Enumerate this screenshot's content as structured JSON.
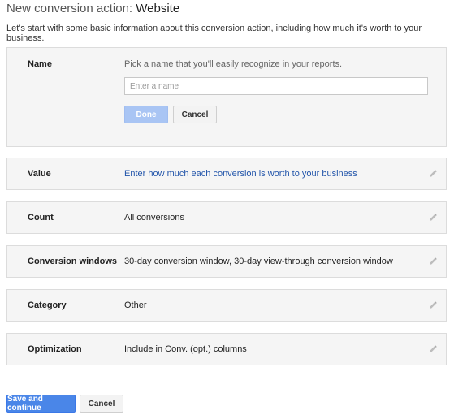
{
  "header": {
    "title_prefix": "New conversion action: ",
    "title_name": "Website",
    "intro": "Let's start with some basic information about this conversion action, including how much it's worth to your business."
  },
  "name_section": {
    "label": "Name",
    "hint": "Pick a name that you'll easily recognize in your reports.",
    "input_value": "",
    "input_placeholder": "Enter a name",
    "done_label": "Done",
    "cancel_label": "Cancel"
  },
  "rows": [
    {
      "label": "Value",
      "value": "Enter how much each conversion is worth to your business"
    },
    {
      "label": "Count",
      "value": "All conversions"
    },
    {
      "label": "Conversion windows",
      "value": "30-day conversion window, 30-day view-through conversion window"
    },
    {
      "label": "Category",
      "value": "Other"
    },
    {
      "label": "Optimization",
      "value": "Include in Conv. (opt.) columns"
    }
  ],
  "footer": {
    "save_label": "Save and continue",
    "cancel_label": "Cancel"
  },
  "icons": {
    "edit": "pencil-icon"
  },
  "colors": {
    "primary_button": "#4a86e8",
    "disabled_button": "#a9c5f4",
    "link": "#2255aa",
    "card_bg": "#f5f5f5"
  }
}
